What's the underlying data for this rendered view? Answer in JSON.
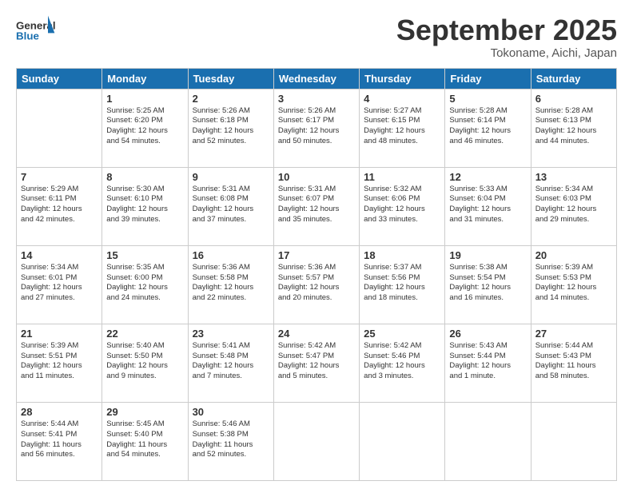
{
  "header": {
    "logo_text_general": "General",
    "logo_text_blue": "Blue",
    "month": "September 2025",
    "location": "Tokoname, Aichi, Japan"
  },
  "days_of_week": [
    "Sunday",
    "Monday",
    "Tuesday",
    "Wednesday",
    "Thursday",
    "Friday",
    "Saturday"
  ],
  "weeks": [
    [
      {
        "day": "",
        "info": ""
      },
      {
        "day": "1",
        "info": "Sunrise: 5:25 AM\nSunset: 6:20 PM\nDaylight: 12 hours\nand 54 minutes."
      },
      {
        "day": "2",
        "info": "Sunrise: 5:26 AM\nSunset: 6:18 PM\nDaylight: 12 hours\nand 52 minutes."
      },
      {
        "day": "3",
        "info": "Sunrise: 5:26 AM\nSunset: 6:17 PM\nDaylight: 12 hours\nand 50 minutes."
      },
      {
        "day": "4",
        "info": "Sunrise: 5:27 AM\nSunset: 6:15 PM\nDaylight: 12 hours\nand 48 minutes."
      },
      {
        "day": "5",
        "info": "Sunrise: 5:28 AM\nSunset: 6:14 PM\nDaylight: 12 hours\nand 46 minutes."
      },
      {
        "day": "6",
        "info": "Sunrise: 5:28 AM\nSunset: 6:13 PM\nDaylight: 12 hours\nand 44 minutes."
      }
    ],
    [
      {
        "day": "7",
        "info": "Sunrise: 5:29 AM\nSunset: 6:11 PM\nDaylight: 12 hours\nand 42 minutes."
      },
      {
        "day": "8",
        "info": "Sunrise: 5:30 AM\nSunset: 6:10 PM\nDaylight: 12 hours\nand 39 minutes."
      },
      {
        "day": "9",
        "info": "Sunrise: 5:31 AM\nSunset: 6:08 PM\nDaylight: 12 hours\nand 37 minutes."
      },
      {
        "day": "10",
        "info": "Sunrise: 5:31 AM\nSunset: 6:07 PM\nDaylight: 12 hours\nand 35 minutes."
      },
      {
        "day": "11",
        "info": "Sunrise: 5:32 AM\nSunset: 6:06 PM\nDaylight: 12 hours\nand 33 minutes."
      },
      {
        "day": "12",
        "info": "Sunrise: 5:33 AM\nSunset: 6:04 PM\nDaylight: 12 hours\nand 31 minutes."
      },
      {
        "day": "13",
        "info": "Sunrise: 5:34 AM\nSunset: 6:03 PM\nDaylight: 12 hours\nand 29 minutes."
      }
    ],
    [
      {
        "day": "14",
        "info": "Sunrise: 5:34 AM\nSunset: 6:01 PM\nDaylight: 12 hours\nand 27 minutes."
      },
      {
        "day": "15",
        "info": "Sunrise: 5:35 AM\nSunset: 6:00 PM\nDaylight: 12 hours\nand 24 minutes."
      },
      {
        "day": "16",
        "info": "Sunrise: 5:36 AM\nSunset: 5:58 PM\nDaylight: 12 hours\nand 22 minutes."
      },
      {
        "day": "17",
        "info": "Sunrise: 5:36 AM\nSunset: 5:57 PM\nDaylight: 12 hours\nand 20 minutes."
      },
      {
        "day": "18",
        "info": "Sunrise: 5:37 AM\nSunset: 5:56 PM\nDaylight: 12 hours\nand 18 minutes."
      },
      {
        "day": "19",
        "info": "Sunrise: 5:38 AM\nSunset: 5:54 PM\nDaylight: 12 hours\nand 16 minutes."
      },
      {
        "day": "20",
        "info": "Sunrise: 5:39 AM\nSunset: 5:53 PM\nDaylight: 12 hours\nand 14 minutes."
      }
    ],
    [
      {
        "day": "21",
        "info": "Sunrise: 5:39 AM\nSunset: 5:51 PM\nDaylight: 12 hours\nand 11 minutes."
      },
      {
        "day": "22",
        "info": "Sunrise: 5:40 AM\nSunset: 5:50 PM\nDaylight: 12 hours\nand 9 minutes."
      },
      {
        "day": "23",
        "info": "Sunrise: 5:41 AM\nSunset: 5:48 PM\nDaylight: 12 hours\nand 7 minutes."
      },
      {
        "day": "24",
        "info": "Sunrise: 5:42 AM\nSunset: 5:47 PM\nDaylight: 12 hours\nand 5 minutes."
      },
      {
        "day": "25",
        "info": "Sunrise: 5:42 AM\nSunset: 5:46 PM\nDaylight: 12 hours\nand 3 minutes."
      },
      {
        "day": "26",
        "info": "Sunrise: 5:43 AM\nSunset: 5:44 PM\nDaylight: 12 hours\nand 1 minute."
      },
      {
        "day": "27",
        "info": "Sunrise: 5:44 AM\nSunset: 5:43 PM\nDaylight: 11 hours\nand 58 minutes."
      }
    ],
    [
      {
        "day": "28",
        "info": "Sunrise: 5:44 AM\nSunset: 5:41 PM\nDaylight: 11 hours\nand 56 minutes."
      },
      {
        "day": "29",
        "info": "Sunrise: 5:45 AM\nSunset: 5:40 PM\nDaylight: 11 hours\nand 54 minutes."
      },
      {
        "day": "30",
        "info": "Sunrise: 5:46 AM\nSunset: 5:38 PM\nDaylight: 11 hours\nand 52 minutes."
      },
      {
        "day": "",
        "info": ""
      },
      {
        "day": "",
        "info": ""
      },
      {
        "day": "",
        "info": ""
      },
      {
        "day": "",
        "info": ""
      }
    ]
  ]
}
